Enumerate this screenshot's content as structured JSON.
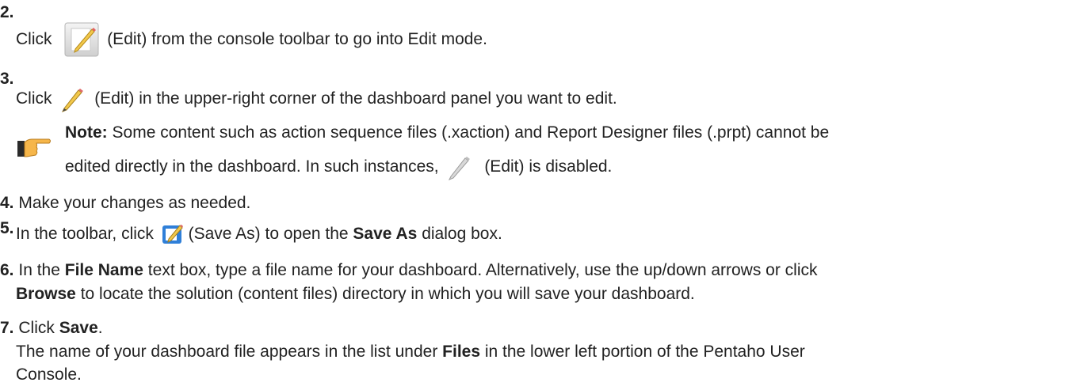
{
  "steps": [
    {
      "num": "2.",
      "pre": "Click",
      "post": "(Edit) from the console toolbar to go into Edit mode.",
      "icon": "edit-toolbar-icon"
    },
    {
      "num": "3.",
      "pre": "Click",
      "post": "(Edit) in the upper-right corner of the dashboard panel you want to edit.",
      "icon": "pencil-icon"
    },
    {
      "note_label": "Note:",
      "note_line1": "Some content such as action sequence files (.xaction) and Report Designer files (.prpt) cannot be",
      "note_line2_pre": "edited directly in the dashboard. In such instances,",
      "note_line2_post": "(Edit) is disabled.",
      "icon": "pointing-hand-icon"
    },
    {
      "num": "4.",
      "text": "Make your changes as needed."
    },
    {
      "num": "5.",
      "pre": "In the toolbar, click",
      "post_a": "(Save As) to open the ",
      "bold": "Save As",
      "post_b": " dialog box.",
      "icon": "save-as-icon"
    },
    {
      "num": "6.",
      "l1_pre": "In the ",
      "l1_bold": "File Name",
      "l1_post": " text box, type a file name for your dashboard. Alternatively, use the up/down arrows or click",
      "l2_bold": "Browse",
      "l2_post": " to locate the solution (content files) directory in which you will save your dashboard."
    },
    {
      "num": "7.",
      "pre": "Click ",
      "bold": "Save",
      "post": ".",
      "l2_pre": "The name of your dashboard file appears in the list under ",
      "l2_bold": "Files",
      "l2_post": " in the lower left portion of the Pentaho User",
      "l3": "Console."
    }
  ]
}
